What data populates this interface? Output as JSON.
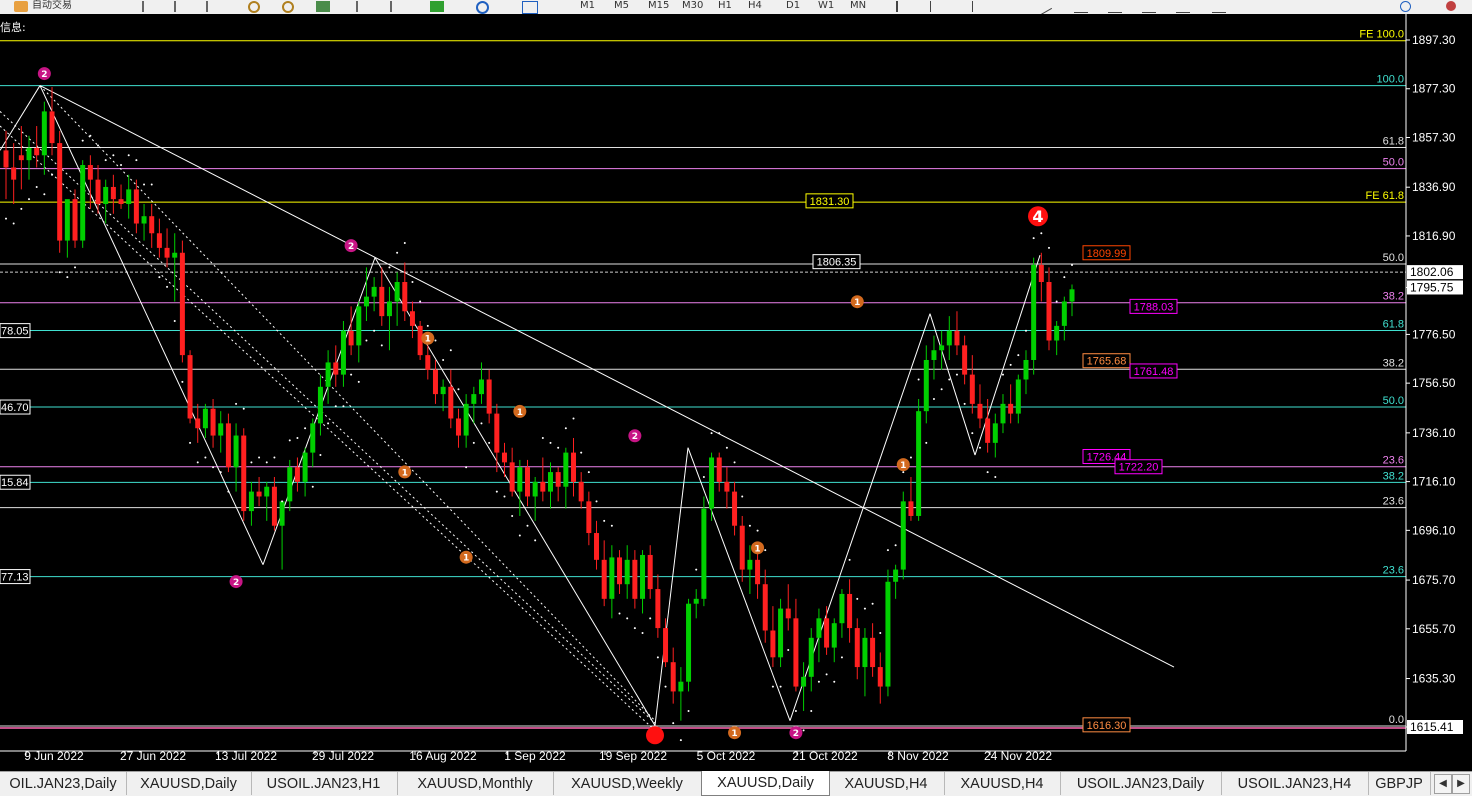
{
  "toolbar": {
    "app_label": "自动交易",
    "timeframes": [
      "M1",
      "M5",
      "M15",
      "M30",
      "H1",
      "H4",
      "D1",
      "W1",
      "MN"
    ]
  },
  "chart_info_label": "信息:",
  "chart_data": {
    "type": "candlestick",
    "symbol": "XAUUSD",
    "timeframe": "Daily",
    "ylim": [
      1608,
      1904
    ],
    "price_ticks": [
      1897.3,
      1877.3,
      1857.3,
      1836.9,
      1816.9,
      1795.75,
      1776.5,
      1756.5,
      1736.1,
      1716.1,
      1696.1,
      1675.7,
      1655.7,
      1635.3,
      1615.41
    ],
    "current_price": 1795.75,
    "crosshair_price": 1802.06,
    "date_labels": [
      "9 Jun 2022",
      "27 Jun 2022",
      "13 Jul 2022",
      "29 Jul 2022",
      "16 Aug 2022",
      "1 Sep 2022",
      "19 Sep 2022",
      "5 Oct 2022",
      "21 Oct 2022",
      "8 Nov 2022",
      "24 Nov 2022"
    ],
    "candles": [
      [
        1852,
        1860,
        1832,
        1845
      ],
      [
        1845,
        1855,
        1830,
        1840
      ],
      [
        1850,
        1862,
        1836,
        1848
      ],
      [
        1848,
        1858,
        1840,
        1853
      ],
      [
        1853,
        1862,
        1845,
        1850
      ],
      [
        1850,
        1872,
        1842,
        1868
      ],
      [
        1868,
        1878,
        1850,
        1855
      ],
      [
        1855,
        1860,
        1810,
        1815
      ],
      [
        1815,
        1830,
        1808,
        1832
      ],
      [
        1832,
        1836,
        1812,
        1815
      ],
      [
        1815,
        1848,
        1812,
        1846
      ],
      [
        1846,
        1850,
        1828,
        1840
      ],
      [
        1840,
        1846,
        1826,
        1830
      ],
      [
        1830,
        1840,
        1822,
        1837
      ],
      [
        1837,
        1842,
        1826,
        1832
      ],
      [
        1832,
        1838,
        1828,
        1830
      ],
      [
        1830,
        1842,
        1824,
        1836
      ],
      [
        1836,
        1840,
        1818,
        1822
      ],
      [
        1822,
        1830,
        1815,
        1825
      ],
      [
        1825,
        1830,
        1812,
        1818
      ],
      [
        1818,
        1824,
        1808,
        1812
      ],
      [
        1812,
        1820,
        1804,
        1808
      ],
      [
        1808,
        1818,
        1790,
        1810
      ],
      [
        1810,
        1815,
        1765,
        1768
      ],
      [
        1768,
        1770,
        1740,
        1742
      ],
      [
        1742,
        1748,
        1732,
        1738
      ],
      [
        1738,
        1748,
        1734,
        1746
      ],
      [
        1746,
        1750,
        1730,
        1735
      ],
      [
        1735,
        1745,
        1728,
        1740
      ],
      [
        1740,
        1744,
        1720,
        1722
      ],
      [
        1722,
        1740,
        1712,
        1735
      ],
      [
        1735,
        1738,
        1700,
        1704
      ],
      [
        1704,
        1716,
        1698,
        1712
      ],
      [
        1712,
        1718,
        1706,
        1710
      ],
      [
        1710,
        1716,
        1700,
        1714
      ],
      [
        1714,
        1718,
        1696,
        1698
      ],
      [
        1698,
        1700,
        1680,
        1708
      ],
      [
        1708,
        1725,
        1704,
        1722
      ],
      [
        1722,
        1726,
        1712,
        1716
      ],
      [
        1716,
        1730,
        1710,
        1728
      ],
      [
        1728,
        1742,
        1722,
        1740
      ],
      [
        1740,
        1760,
        1735,
        1755
      ],
      [
        1755,
        1770,
        1748,
        1765
      ],
      [
        1765,
        1772,
        1755,
        1760
      ],
      [
        1760,
        1782,
        1755,
        1778
      ],
      [
        1778,
        1788,
        1768,
        1772
      ],
      [
        1772,
        1790,
        1765,
        1788
      ],
      [
        1788,
        1804,
        1782,
        1792
      ],
      [
        1792,
        1800,
        1786,
        1796
      ],
      [
        1796,
        1804,
        1780,
        1784
      ],
      [
        1784,
        1796,
        1770,
        1790
      ],
      [
        1790,
        1802,
        1780,
        1798
      ],
      [
        1798,
        1806,
        1782,
        1786
      ],
      [
        1786,
        1790,
        1775,
        1780
      ],
      [
        1780,
        1782,
        1766,
        1768
      ],
      [
        1768,
        1772,
        1758,
        1762
      ],
      [
        1762,
        1766,
        1748,
        1752
      ],
      [
        1752,
        1758,
        1745,
        1755
      ],
      [
        1755,
        1762,
        1738,
        1742
      ],
      [
        1742,
        1746,
        1730,
        1735
      ],
      [
        1735,
        1752,
        1730,
        1748
      ],
      [
        1748,
        1755,
        1740,
        1752
      ],
      [
        1752,
        1765,
        1748,
        1758
      ],
      [
        1758,
        1762,
        1740,
        1744
      ],
      [
        1744,
        1748,
        1720,
        1728
      ],
      [
        1728,
        1732,
        1718,
        1724
      ],
      [
        1724,
        1730,
        1710,
        1712
      ],
      [
        1712,
        1725,
        1702,
        1722
      ],
      [
        1722,
        1725,
        1706,
        1710
      ],
      [
        1710,
        1718,
        1700,
        1716
      ],
      [
        1716,
        1726,
        1708,
        1712
      ],
      [
        1712,
        1724,
        1705,
        1720
      ],
      [
        1720,
        1722,
        1708,
        1714
      ],
      [
        1714,
        1730,
        1705,
        1728
      ],
      [
        1728,
        1734,
        1710,
        1716
      ],
      [
        1716,
        1720,
        1705,
        1708
      ],
      [
        1708,
        1712,
        1690,
        1695
      ],
      [
        1695,
        1700,
        1680,
        1684
      ],
      [
        1684,
        1692,
        1665,
        1668
      ],
      [
        1668,
        1690,
        1660,
        1685
      ],
      [
        1685,
        1688,
        1670,
        1674
      ],
      [
        1674,
        1690,
        1668,
        1684
      ],
      [
        1684,
        1688,
        1664,
        1668
      ],
      [
        1668,
        1688,
        1662,
        1686
      ],
      [
        1686,
        1690,
        1668,
        1672
      ],
      [
        1672,
        1678,
        1652,
        1656
      ],
      [
        1656,
        1660,
        1640,
        1642
      ],
      [
        1642,
        1648,
        1625,
        1630
      ],
      [
        1630,
        1640,
        1618,
        1634
      ],
      [
        1634,
        1668,
        1630,
        1666
      ],
      [
        1666,
        1672,
        1660,
        1668
      ],
      [
        1668,
        1710,
        1665,
        1705
      ],
      [
        1705,
        1728,
        1700,
        1726
      ],
      [
        1726,
        1728,
        1712,
        1716
      ],
      [
        1716,
        1722,
        1705,
        1712
      ],
      [
        1712,
        1716,
        1694,
        1698
      ],
      [
        1698,
        1702,
        1675,
        1680
      ],
      [
        1680,
        1690,
        1670,
        1684
      ],
      [
        1684,
        1688,
        1668,
        1674
      ],
      [
        1674,
        1680,
        1650,
        1655
      ],
      [
        1655,
        1665,
        1640,
        1644
      ],
      [
        1644,
        1668,
        1640,
        1664
      ],
      [
        1664,
        1674,
        1655,
        1660
      ],
      [
        1660,
        1668,
        1630,
        1632
      ],
      [
        1632,
        1642,
        1622,
        1636
      ],
      [
        1636,
        1656,
        1630,
        1652
      ],
      [
        1652,
        1664,
        1642,
        1660
      ],
      [
        1660,
        1665,
        1645,
        1648
      ],
      [
        1648,
        1660,
        1642,
        1658
      ],
      [
        1658,
        1672,
        1652,
        1670
      ],
      [
        1670,
        1676,
        1650,
        1656
      ],
      [
        1656,
        1660,
        1635,
        1640
      ],
      [
        1640,
        1656,
        1628,
        1652
      ],
      [
        1652,
        1658,
        1636,
        1640
      ],
      [
        1640,
        1646,
        1625,
        1632
      ],
      [
        1632,
        1680,
        1628,
        1675
      ],
      [
        1675,
        1682,
        1668,
        1680
      ],
      [
        1680,
        1712,
        1676,
        1708
      ],
      [
        1708,
        1718,
        1700,
        1702
      ],
      [
        1702,
        1750,
        1700,
        1745
      ],
      [
        1745,
        1772,
        1740,
        1766
      ],
      [
        1766,
        1776,
        1758,
        1770
      ],
      [
        1770,
        1778,
        1762,
        1772
      ],
      [
        1772,
        1784,
        1766,
        1778
      ],
      [
        1778,
        1786,
        1768,
        1772
      ],
      [
        1772,
        1776,
        1756,
        1760
      ],
      [
        1760,
        1768,
        1744,
        1748
      ],
      [
        1748,
        1756,
        1738,
        1742
      ],
      [
        1742,
        1750,
        1728,
        1732
      ],
      [
        1732,
        1744,
        1726,
        1740
      ],
      [
        1740,
        1752,
        1736,
        1748
      ],
      [
        1748,
        1756,
        1740,
        1744
      ],
      [
        1744,
        1760,
        1740,
        1758
      ],
      [
        1758,
        1770,
        1752,
        1766
      ],
      [
        1766,
        1808,
        1760,
        1805
      ],
      [
        1805,
        1810,
        1790,
        1798
      ],
      [
        1798,
        1804,
        1770,
        1774
      ],
      [
        1774,
        1782,
        1768,
        1780
      ],
      [
        1780,
        1792,
        1774,
        1790
      ],
      [
        1790,
        1797,
        1784,
        1795
      ]
    ],
    "fibo_levels_left": [
      {
        "label": "FE 100.0",
        "value": 1897.0,
        "color": "#ffff00"
      },
      {
        "label": "100.0",
        "value": 1878.6,
        "color": "#40e0d0"
      },
      {
        "label": "61.8",
        "value": 1853.2,
        "color": "#e0e0e0"
      },
      {
        "label": "50.0",
        "value": 1844.5,
        "color": "#ee82ee"
      },
      {
        "label": "FE 61.8",
        "value": 1830.8,
        "color": "#ffff00"
      },
      {
        "label": "50.0",
        "value": 1805.4,
        "color": "#e0e0e0"
      },
      {
        "label": "38.2",
        "value": 1789.5,
        "color": "#ee82ee"
      },
      {
        "label": "61.8",
        "value": 1778.1,
        "color": "#40e0d0"
      },
      {
        "label": "38.2",
        "value": 1762.2,
        "color": "#e0e0e0"
      },
      {
        "label": "50.0",
        "value": 1746.7,
        "color": "#40e0d0"
      },
      {
        "label": "23.6",
        "value": 1722.2,
        "color": "#ee82ee"
      },
      {
        "label": "38.2",
        "value": 1715.8,
        "color": "#40e0d0"
      },
      {
        "label": "23.6",
        "value": 1705.4,
        "color": "#e0e0e0"
      },
      {
        "label": "23.6",
        "value": 1677.1,
        "color": "#40e0d0"
      },
      {
        "label": "0.0",
        "value": 1615.8,
        "color": "#e0e0e0"
      }
    ],
    "level_value_labels": [
      {
        "text": "1831.30",
        "value": 1831.3,
        "fg": "#ffff00",
        "border": "#ffff00"
      },
      {
        "text": "1806.35",
        "value": 1806.35,
        "fg": "#ffffff",
        "border": "#ffffff"
      },
      {
        "text": "1809.99",
        "value": 1810.0,
        "fg": "#ff4500",
        "border": "#ff4500"
      },
      {
        "text": "1788.03",
        "value": 1788.0,
        "fg": "#ff00ff",
        "border": "#ff00ff"
      },
      {
        "text": "1765.68",
        "value": 1765.7,
        "fg": "#ff8c42",
        "border": "#ff8c42"
      },
      {
        "text": "1761.48",
        "value": 1761.5,
        "fg": "#ff00ff",
        "border": "#ff00ff"
      },
      {
        "text": "1726.44",
        "value": 1726.4,
        "fg": "#ff00ff",
        "border": "#ff00ff"
      },
      {
        "text": "1722.20",
        "value": 1722.2,
        "fg": "#ff00ff",
        "border": "#ff00ff"
      },
      {
        "text": "1616.30",
        "value": 1616.3,
        "fg": "#ff8c42",
        "border": "#ff8c42"
      }
    ],
    "left_edge_labels": [
      {
        "text": "78.05",
        "value": 1778.05
      },
      {
        "text": "46.70",
        "value": 1746.7
      },
      {
        "text": "15.84",
        "value": 1715.84
      },
      {
        "text": "77.13",
        "value": 1677.13
      }
    ],
    "wave_points": [
      {
        "label": "2",
        "color": "#c71585",
        "x_index": 5,
        "price": 1878.6,
        "pos": "above"
      },
      {
        "label": "2",
        "color": "#c71585",
        "x_index": 30,
        "price": 1680,
        "pos": "below"
      },
      {
        "label": "2",
        "color": "#c71585",
        "x_index": 45,
        "price": 1808,
        "pos": "above"
      },
      {
        "label": "1",
        "color": "#d2691e",
        "x_index": 55,
        "price": 1770,
        "pos": "above"
      },
      {
        "label": "1",
        "color": "#d2691e",
        "x_index": 52,
        "price": 1725,
        "pos": "below"
      },
      {
        "label": "1",
        "color": "#d2691e",
        "x_index": 67,
        "price": 1740,
        "pos": "above"
      },
      {
        "label": "1",
        "color": "#d2691e",
        "x_index": 60,
        "price": 1690,
        "pos": "below"
      },
      {
        "label": "2",
        "color": "#c71585",
        "x_index": 82,
        "price": 1730,
        "pos": "above"
      },
      {
        "label": "1",
        "color": "#d2691e",
        "x_index": 95,
        "price": 1618,
        "pos": "below"
      },
      {
        "label": "2",
        "color": "#c71585",
        "x_index": 103,
        "price": 1618,
        "pos": "below"
      },
      {
        "label": "1",
        "color": "#d2691e",
        "x_index": 98,
        "price": 1684,
        "pos": "above"
      },
      {
        "label": "1",
        "color": "#d2691e",
        "x_index": 111,
        "price": 1785,
        "pos": "above"
      },
      {
        "label": "1",
        "color": "#d2691e",
        "x_index": 117,
        "price": 1728,
        "pos": "below"
      }
    ],
    "wave4_label": "4"
  },
  "tabs": [
    {
      "label": "OIL.JAN23,Daily",
      "active": false
    },
    {
      "label": "XAUUSD,Daily",
      "active": false
    },
    {
      "label": "USOIL.JAN23,H1",
      "active": false
    },
    {
      "label": "XAUUSD,Monthly",
      "active": false
    },
    {
      "label": "XAUUSD,Weekly",
      "active": false
    },
    {
      "label": "XAUUSD,Daily",
      "active": true
    },
    {
      "label": "XAUUSD,H4",
      "active": false
    },
    {
      "label": "XAUUSD,H4",
      "active": false
    },
    {
      "label": "USOIL.JAN23,Daily",
      "active": false
    },
    {
      "label": "USOIL.JAN23,H4",
      "active": false
    },
    {
      "label": "GBPJP",
      "active": false
    }
  ],
  "tab_nav": {
    "left": "◀",
    "right": "▶"
  }
}
